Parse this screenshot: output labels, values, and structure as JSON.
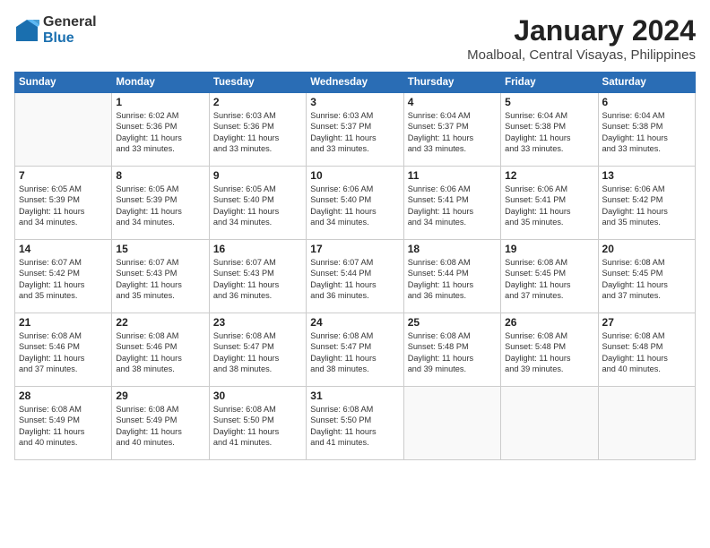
{
  "logo": {
    "general": "General",
    "blue": "Blue"
  },
  "header": {
    "month": "January 2024",
    "location": "Moalboal, Central Visayas, Philippines"
  },
  "weekdays": [
    "Sunday",
    "Monday",
    "Tuesday",
    "Wednesday",
    "Thursday",
    "Friday",
    "Saturday"
  ],
  "weeks": [
    [
      {
        "day": "",
        "lines": []
      },
      {
        "day": "1",
        "lines": [
          "Sunrise: 6:02 AM",
          "Sunset: 5:36 PM",
          "Daylight: 11 hours",
          "and 33 minutes."
        ]
      },
      {
        "day": "2",
        "lines": [
          "Sunrise: 6:03 AM",
          "Sunset: 5:36 PM",
          "Daylight: 11 hours",
          "and 33 minutes."
        ]
      },
      {
        "day": "3",
        "lines": [
          "Sunrise: 6:03 AM",
          "Sunset: 5:37 PM",
          "Daylight: 11 hours",
          "and 33 minutes."
        ]
      },
      {
        "day": "4",
        "lines": [
          "Sunrise: 6:04 AM",
          "Sunset: 5:37 PM",
          "Daylight: 11 hours",
          "and 33 minutes."
        ]
      },
      {
        "day": "5",
        "lines": [
          "Sunrise: 6:04 AM",
          "Sunset: 5:38 PM",
          "Daylight: 11 hours",
          "and 33 minutes."
        ]
      },
      {
        "day": "6",
        "lines": [
          "Sunrise: 6:04 AM",
          "Sunset: 5:38 PM",
          "Daylight: 11 hours",
          "and 33 minutes."
        ]
      }
    ],
    [
      {
        "day": "7",
        "lines": [
          "Sunrise: 6:05 AM",
          "Sunset: 5:39 PM",
          "Daylight: 11 hours",
          "and 34 minutes."
        ]
      },
      {
        "day": "8",
        "lines": [
          "Sunrise: 6:05 AM",
          "Sunset: 5:39 PM",
          "Daylight: 11 hours",
          "and 34 minutes."
        ]
      },
      {
        "day": "9",
        "lines": [
          "Sunrise: 6:05 AM",
          "Sunset: 5:40 PM",
          "Daylight: 11 hours",
          "and 34 minutes."
        ]
      },
      {
        "day": "10",
        "lines": [
          "Sunrise: 6:06 AM",
          "Sunset: 5:40 PM",
          "Daylight: 11 hours",
          "and 34 minutes."
        ]
      },
      {
        "day": "11",
        "lines": [
          "Sunrise: 6:06 AM",
          "Sunset: 5:41 PM",
          "Daylight: 11 hours",
          "and 34 minutes."
        ]
      },
      {
        "day": "12",
        "lines": [
          "Sunrise: 6:06 AM",
          "Sunset: 5:41 PM",
          "Daylight: 11 hours",
          "and 35 minutes."
        ]
      },
      {
        "day": "13",
        "lines": [
          "Sunrise: 6:06 AM",
          "Sunset: 5:42 PM",
          "Daylight: 11 hours",
          "and 35 minutes."
        ]
      }
    ],
    [
      {
        "day": "14",
        "lines": [
          "Sunrise: 6:07 AM",
          "Sunset: 5:42 PM",
          "Daylight: 11 hours",
          "and 35 minutes."
        ]
      },
      {
        "day": "15",
        "lines": [
          "Sunrise: 6:07 AM",
          "Sunset: 5:43 PM",
          "Daylight: 11 hours",
          "and 35 minutes."
        ]
      },
      {
        "day": "16",
        "lines": [
          "Sunrise: 6:07 AM",
          "Sunset: 5:43 PM",
          "Daylight: 11 hours",
          "and 36 minutes."
        ]
      },
      {
        "day": "17",
        "lines": [
          "Sunrise: 6:07 AM",
          "Sunset: 5:44 PM",
          "Daylight: 11 hours",
          "and 36 minutes."
        ]
      },
      {
        "day": "18",
        "lines": [
          "Sunrise: 6:08 AM",
          "Sunset: 5:44 PM",
          "Daylight: 11 hours",
          "and 36 minutes."
        ]
      },
      {
        "day": "19",
        "lines": [
          "Sunrise: 6:08 AM",
          "Sunset: 5:45 PM",
          "Daylight: 11 hours",
          "and 37 minutes."
        ]
      },
      {
        "day": "20",
        "lines": [
          "Sunrise: 6:08 AM",
          "Sunset: 5:45 PM",
          "Daylight: 11 hours",
          "and 37 minutes."
        ]
      }
    ],
    [
      {
        "day": "21",
        "lines": [
          "Sunrise: 6:08 AM",
          "Sunset: 5:46 PM",
          "Daylight: 11 hours",
          "and 37 minutes."
        ]
      },
      {
        "day": "22",
        "lines": [
          "Sunrise: 6:08 AM",
          "Sunset: 5:46 PM",
          "Daylight: 11 hours",
          "and 38 minutes."
        ]
      },
      {
        "day": "23",
        "lines": [
          "Sunrise: 6:08 AM",
          "Sunset: 5:47 PM",
          "Daylight: 11 hours",
          "and 38 minutes."
        ]
      },
      {
        "day": "24",
        "lines": [
          "Sunrise: 6:08 AM",
          "Sunset: 5:47 PM",
          "Daylight: 11 hours",
          "and 38 minutes."
        ]
      },
      {
        "day": "25",
        "lines": [
          "Sunrise: 6:08 AM",
          "Sunset: 5:48 PM",
          "Daylight: 11 hours",
          "and 39 minutes."
        ]
      },
      {
        "day": "26",
        "lines": [
          "Sunrise: 6:08 AM",
          "Sunset: 5:48 PM",
          "Daylight: 11 hours",
          "and 39 minutes."
        ]
      },
      {
        "day": "27",
        "lines": [
          "Sunrise: 6:08 AM",
          "Sunset: 5:48 PM",
          "Daylight: 11 hours",
          "and 40 minutes."
        ]
      }
    ],
    [
      {
        "day": "28",
        "lines": [
          "Sunrise: 6:08 AM",
          "Sunset: 5:49 PM",
          "Daylight: 11 hours",
          "and 40 minutes."
        ]
      },
      {
        "day": "29",
        "lines": [
          "Sunrise: 6:08 AM",
          "Sunset: 5:49 PM",
          "Daylight: 11 hours",
          "and 40 minutes."
        ]
      },
      {
        "day": "30",
        "lines": [
          "Sunrise: 6:08 AM",
          "Sunset: 5:50 PM",
          "Daylight: 11 hours",
          "and 41 minutes."
        ]
      },
      {
        "day": "31",
        "lines": [
          "Sunrise: 6:08 AM",
          "Sunset: 5:50 PM",
          "Daylight: 11 hours",
          "and 41 minutes."
        ]
      },
      {
        "day": "",
        "lines": []
      },
      {
        "day": "",
        "lines": []
      },
      {
        "day": "",
        "lines": []
      }
    ]
  ]
}
